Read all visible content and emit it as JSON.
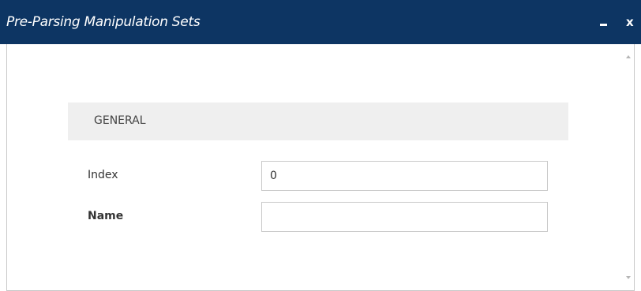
{
  "window": {
    "title": "Pre-Parsing Manipulation Sets",
    "minimize_icon": "minimize-icon",
    "close_label": "x",
    "titlebar_color": "#0d3563"
  },
  "section": {
    "title": "GENERAL"
  },
  "fields": {
    "index": {
      "label": "Index",
      "value": "0",
      "placeholder": ""
    },
    "name": {
      "label": "Name",
      "value": "",
      "placeholder": ""
    }
  }
}
